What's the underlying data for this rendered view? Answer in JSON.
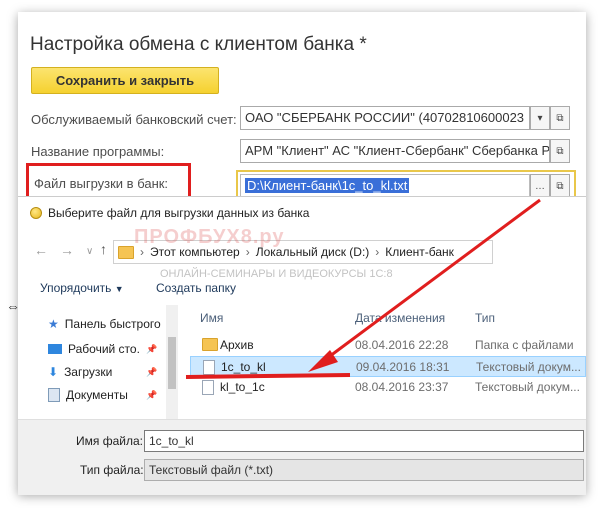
{
  "form": {
    "title": "Настройка обмена с клиентом банка *",
    "save_button": "Сохранить и закрыть",
    "account_label": "Обслуживаемый банковский счет:",
    "account_value": "ОАО \"СБЕРБАНК РОССИИ\" (40702810600023",
    "program_label": "Название программы:",
    "program_value": "АРМ \"Клиент\" АС \"Клиент-Сбербанк\" Сбербанка Р",
    "file_label": "Файл выгрузки в банк:",
    "file_value": "D:\\Клиент-банк\\1c_to_kl.txt"
  },
  "dialog": {
    "title": "Выберите файл для выгрузки данных из банка",
    "breadcrumb": [
      "Этот компьютер",
      "Локальный диск (D:)",
      "Клиент-банк"
    ],
    "organize_label": "Упорядочить",
    "new_folder_label": "Создать папку",
    "sidebar": [
      {
        "label": "Панель быстрого",
        "icon": "star-icon"
      },
      {
        "label": "Рабочий сто.",
        "icon": "desktop-icon"
      },
      {
        "label": "Загрузки",
        "icon": "download-icon"
      },
      {
        "label": "Документы",
        "icon": "documents-icon"
      }
    ],
    "columns": {
      "name": "Имя",
      "date": "Дата изменения",
      "type": "Тип"
    },
    "files": [
      {
        "name": "Архив",
        "date": "08.04.2016 22:28",
        "type": "Папка с файлами",
        "icon": "folder-icon"
      },
      {
        "name": "1c_to_kl",
        "date": "09.04.2016 18:31",
        "type": "Текстовый докум...",
        "icon": "text-file-icon",
        "selected": true
      },
      {
        "name": "kl_to_1c",
        "date": "08.04.2016 23:37",
        "type": "Текстовый докум...",
        "icon": "text-file-icon"
      }
    ],
    "filename_label": "Имя файла:",
    "filename_value": "1c_to_kl",
    "filetype_label": "Тип файла:",
    "filetype_value": "Текстовый файл (*.txt)"
  },
  "watermark": {
    "logo": "ПРОФБУХ8.ру",
    "subtitle": "ОНЛАЙН-СЕМИНАРЫ И ВИДЕОКУРСЫ 1С:8"
  },
  "colors": {
    "accent_red": "#e01e1e",
    "save_yellow": "#f5d12f",
    "selection": "#cce8ff"
  }
}
